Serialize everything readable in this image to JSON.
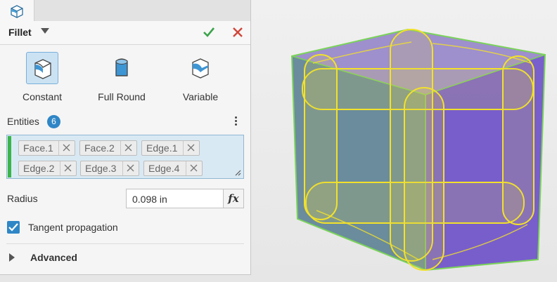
{
  "panel": {
    "title": "Fillet",
    "fillet_types": [
      {
        "label": "Constant",
        "selected": true
      },
      {
        "label": "Full Round",
        "selected": false
      },
      {
        "label": "Variable",
        "selected": false
      }
    ],
    "entities": {
      "label": "Entities",
      "count": "6",
      "chips": [
        "Face.1",
        "Face.2",
        "Edge.1",
        "Edge.2",
        "Edge.3",
        "Edge.4"
      ]
    },
    "radius": {
      "label": "Radius",
      "value": "0.098 in",
      "fx_label": "fx"
    },
    "tangent_propagation": {
      "label": "Tangent propagation",
      "checked": true
    },
    "advanced": {
      "label": "Advanced"
    }
  },
  "colors": {
    "accent": "#2f86c6",
    "ok_green": "#3aa34a",
    "cancel_red": "#d0453a",
    "edge_highlight": "#f2e12a",
    "selection_bar": "#39b54a"
  },
  "icons": [
    "fillet-tab-icon",
    "dropdown-arrow-icon",
    "checkmark-icon",
    "close-icon",
    "constant-fillet-icon",
    "full-round-fillet-icon",
    "variable-fillet-icon",
    "more-options-icon",
    "remove-chip-icon",
    "resize-grip-icon",
    "expand-arrow-icon"
  ]
}
